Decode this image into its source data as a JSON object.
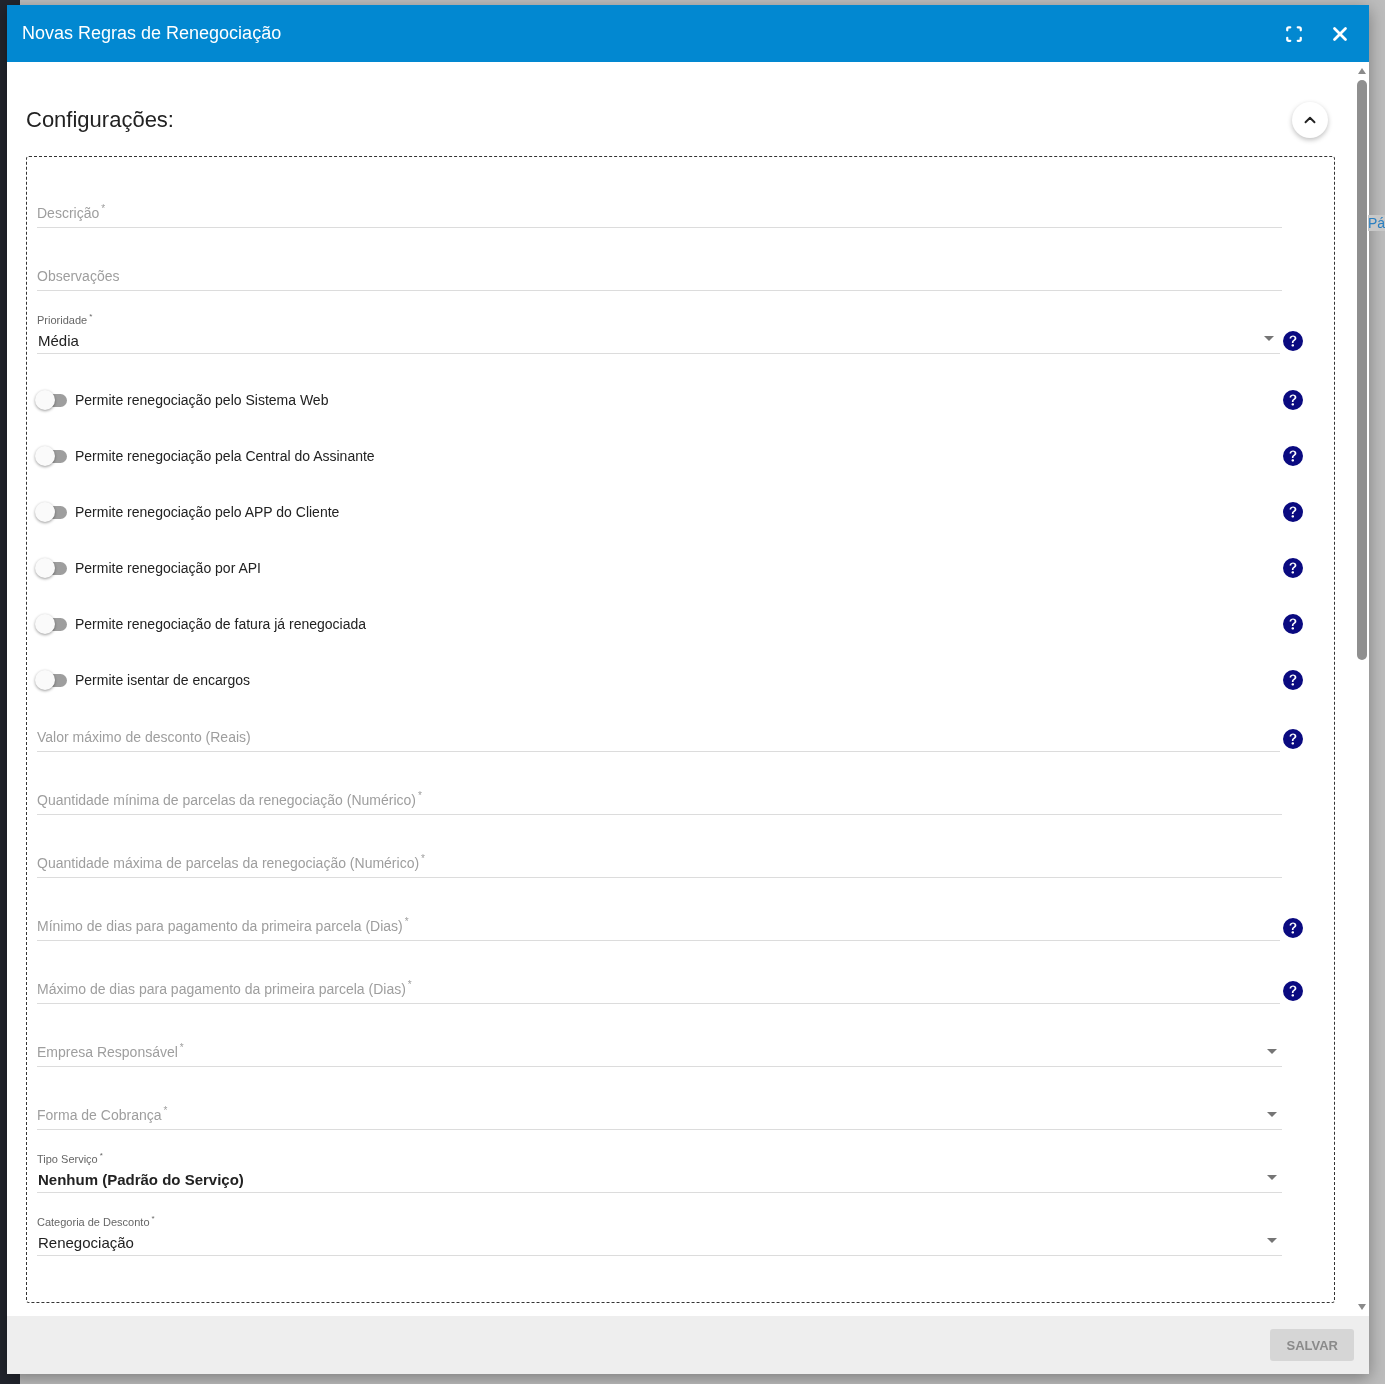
{
  "backdrop": {
    "link": "Pá"
  },
  "dialog": {
    "title": "Novas Regras de Renegociação"
  },
  "section": {
    "title": "Configurações:",
    "expanded": true
  },
  "items": [
    {
      "kind": "text",
      "label": "Descrição",
      "mark": "*",
      "help": false
    },
    {
      "kind": "text",
      "label": "Observações",
      "help": false
    },
    {
      "kind": "select",
      "label": "Prioridade",
      "mark": "*",
      "value": "Média",
      "help": true
    },
    {
      "kind": "toggle",
      "label": "Permite renegociação pelo Sistema Web",
      "on": false,
      "help": true
    },
    {
      "kind": "toggle",
      "label": "Permite renegociação pela Central do Assinante",
      "on": false,
      "help": true
    },
    {
      "kind": "toggle",
      "label": "Permite renegociação pelo APP do Cliente",
      "on": false,
      "help": true
    },
    {
      "kind": "toggle",
      "label": "Permite renegociação por API",
      "on": false,
      "help": true
    },
    {
      "kind": "toggle",
      "label": "Permite renegociação de fatura já renegociada",
      "on": false,
      "help": true
    },
    {
      "kind": "toggle",
      "label": "Permite isentar de encargos",
      "on": false,
      "help": true
    },
    {
      "kind": "text",
      "label": "Valor máximo de desconto (Reais)",
      "help": true
    },
    {
      "kind": "text",
      "label": "Quantidade mínima de parcelas da renegociação (Numérico)",
      "mark": "*",
      "help": false
    },
    {
      "kind": "text",
      "label": "Quantidade máxima de parcelas da renegociação (Numérico)",
      "mark": "*",
      "help": false
    },
    {
      "kind": "text",
      "label": "Mínimo de dias para pagamento da primeira parcela (Dias)",
      "mark": "*",
      "help": true
    },
    {
      "kind": "text",
      "label": "Máximo de dias para pagamento da primeira parcela (Dias)",
      "mark": "*",
      "help": true
    },
    {
      "kind": "select",
      "label": "Empresa Responsável",
      "mark": "*",
      "help": false
    },
    {
      "kind": "select",
      "label": "Forma de Cobrança",
      "mark": "*",
      "help": false
    },
    {
      "kind": "select",
      "label": "Tipo Serviço",
      "mark": "*",
      "value": "Nenhum (Padrão do Serviço)",
      "bold": true,
      "help": false
    },
    {
      "kind": "select",
      "label": "Categoria de Desconto",
      "mark": "*",
      "value": "Renegociação",
      "help": false
    }
  ],
  "footer": {
    "save": {
      "label": "SALVAR",
      "disabled": true
    }
  }
}
